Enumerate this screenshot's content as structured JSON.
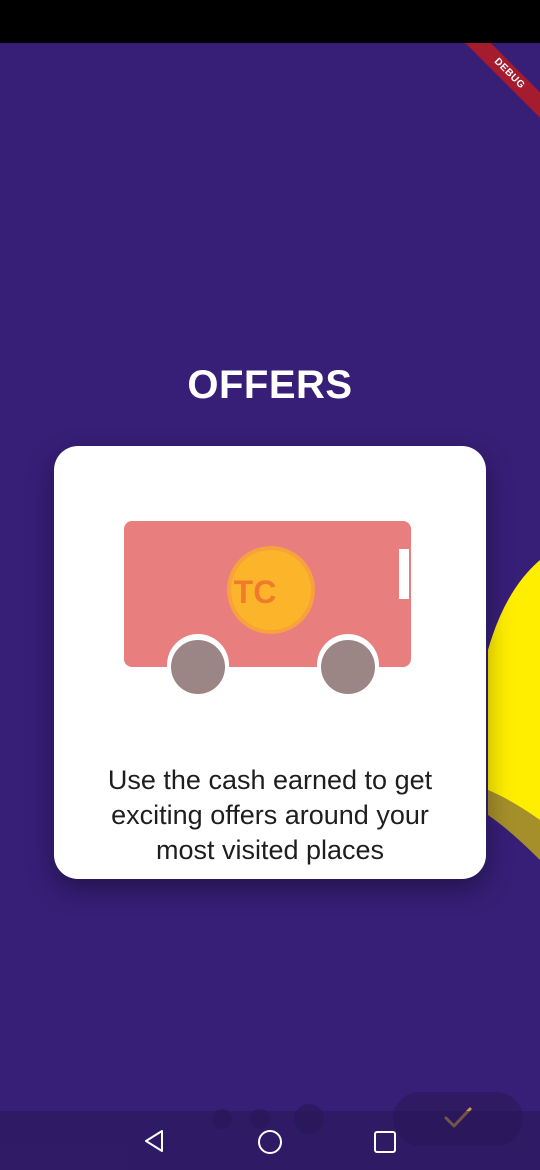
{
  "app": {
    "debug_label": "DEBUG"
  },
  "onboarding": {
    "title": "OFFERS",
    "description_lines": [
      "Use the cash earned to get",
      "exciting offers around your",
      "most visited places"
    ],
    "coin_label": "TC",
    "page_indicator": {
      "count": 3,
      "active_index": 2
    }
  },
  "buttons": {
    "done_icon": "check-icon"
  },
  "system_nav": {
    "back_icon": "back-triangle-icon",
    "home_icon": "home-circle-icon",
    "recents_icon": "recents-square-icon"
  },
  "colors": {
    "background": "#371e77",
    "card": "#ffffff",
    "truck_body": "#e97e7e",
    "wheel": "#9b8585",
    "coin": "#fcb52a",
    "coin_text": "#f07b2d",
    "blob_yellow": "#ffee00",
    "check": "#c9a035"
  }
}
